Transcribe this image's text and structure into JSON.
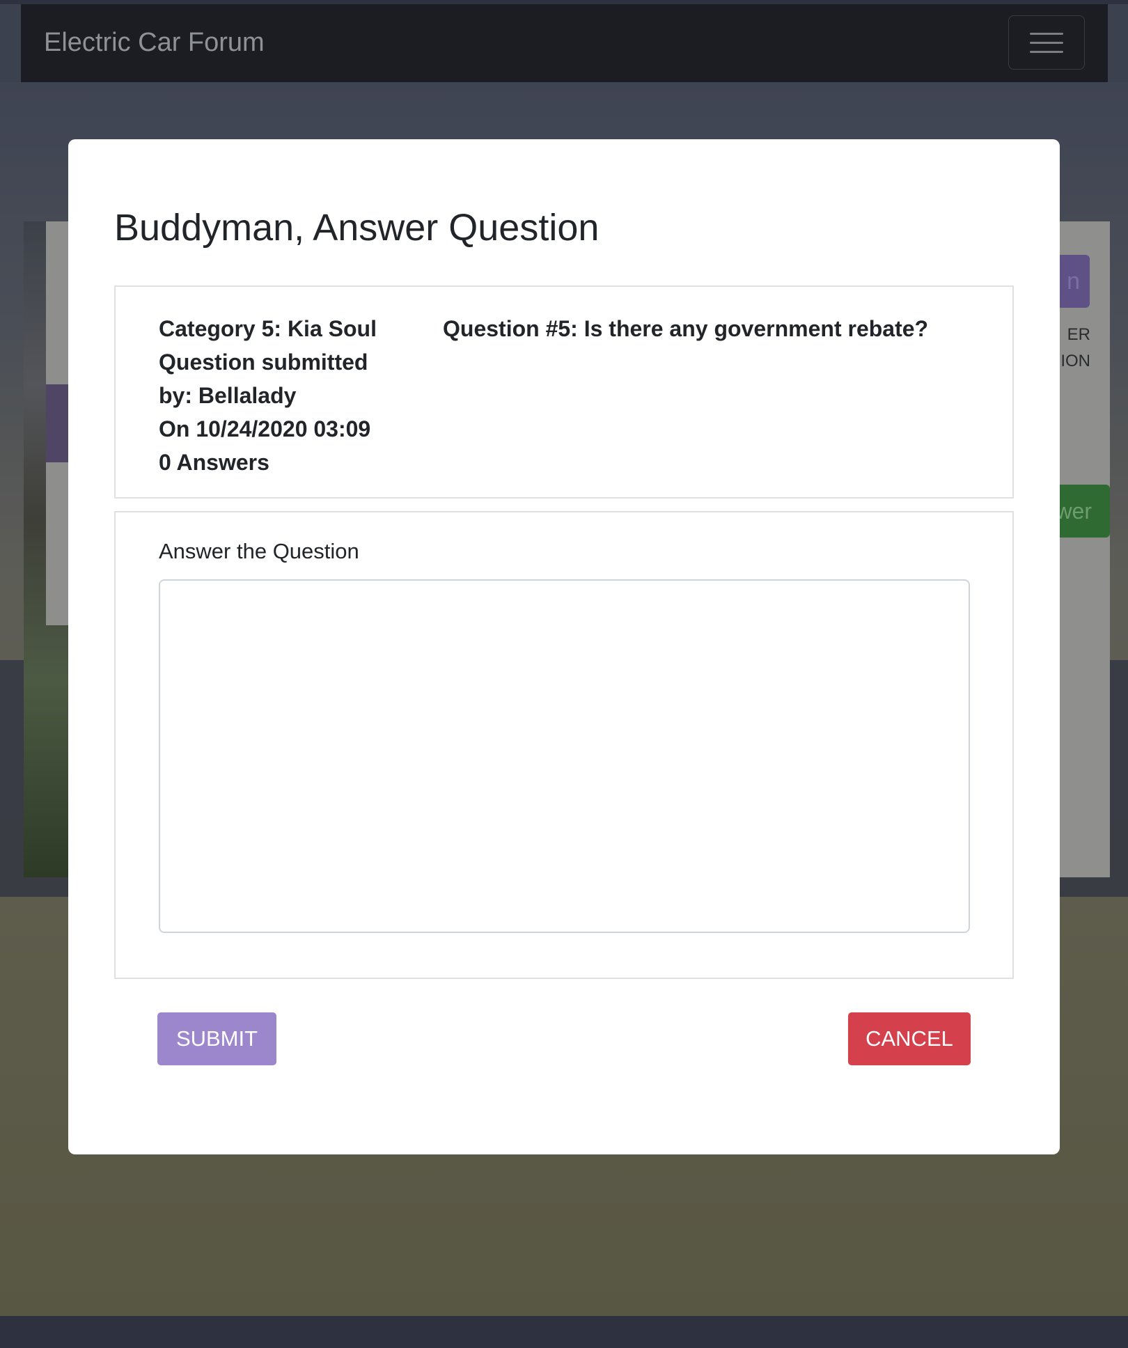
{
  "navbar": {
    "brand": "Electric Car Forum",
    "menu_icon": "hamburger-menu-icon"
  },
  "background": {
    "side_button_fragment": "n",
    "side_text_line1": "ER",
    "side_text_line2": "ION",
    "green_button_fragment": "wer"
  },
  "modal": {
    "title": "Buddyman, Answer Question",
    "info": {
      "category": "Category 5: Kia Soul",
      "submitted_line1": "Question submitted",
      "submitted_line2": "by: Bellalady",
      "date": "On 10/24/2020 03:09",
      "answers_count": "0 Answers",
      "question": "Question #5: Is there any government rebate?"
    },
    "answer": {
      "label": "Answer the Question",
      "value": "",
      "placeholder": ""
    },
    "submit_label": "SUBMIT",
    "cancel_label": "CANCEL"
  },
  "colors": {
    "submit": "#9c87cc",
    "cancel": "#d4414c",
    "navbar": "#1b1d22"
  }
}
